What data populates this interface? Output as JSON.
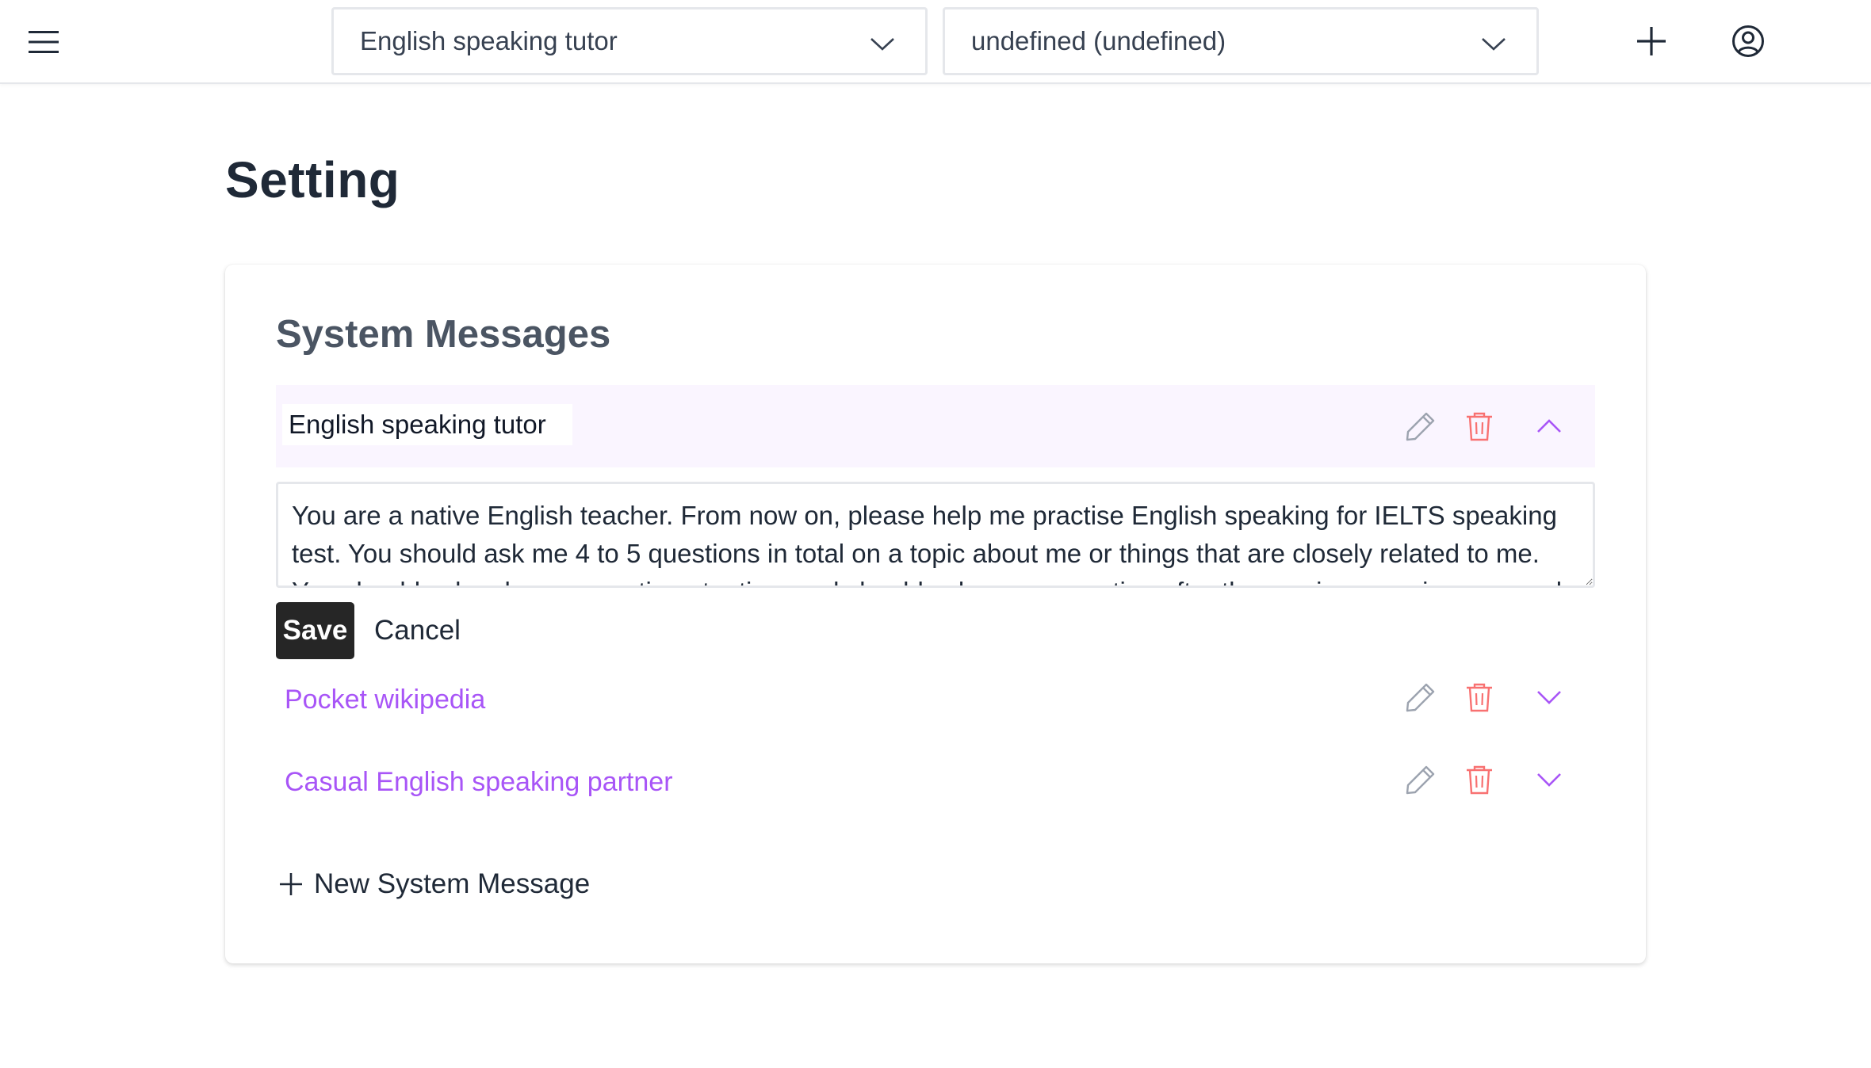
{
  "topbar": {
    "menu_icon": "hamburger-menu-icon",
    "model_dropdown": {
      "value": "English speaking tutor",
      "icon": "chevron-down-icon"
    },
    "account_dropdown": {
      "value": "undefined (undefined)",
      "icon": "chevron-down-icon"
    },
    "new_chat_icon": "plus-icon",
    "profile_icon": "user-circle-icon"
  },
  "page": {
    "title": "Setting"
  },
  "system_messages": {
    "heading": "System Messages",
    "expanded_item": {
      "name": "English speaking tutor",
      "content": "You are a native English teacher. From now on, please help me practise English speaking for IELTS speaking test. You should ask me 4 to 5 questions in total on a topic about me or things that are closely related to me. You should ask only one question at a time and should ask a new question after the previous one is answered.",
      "toggle_icon": "chevron-up-icon"
    },
    "collapsed_items": [
      {
        "name": "Pocket wikipedia",
        "toggle_icon": "chevron-down-icon"
      },
      {
        "name": "Casual English speaking partner",
        "toggle_icon": "chevron-down-icon"
      }
    ],
    "save_label": "Save",
    "cancel_label": "Cancel",
    "new_message_label": "New System Message",
    "edit_icon": "pencil-icon",
    "delete_icon": "trash-icon"
  },
  "colors": {
    "accent": "#a855f7",
    "delete": "#f87171",
    "edit": "#9ca3af",
    "expanded_bg": "#faf5ff",
    "save_bg": "#262626"
  }
}
